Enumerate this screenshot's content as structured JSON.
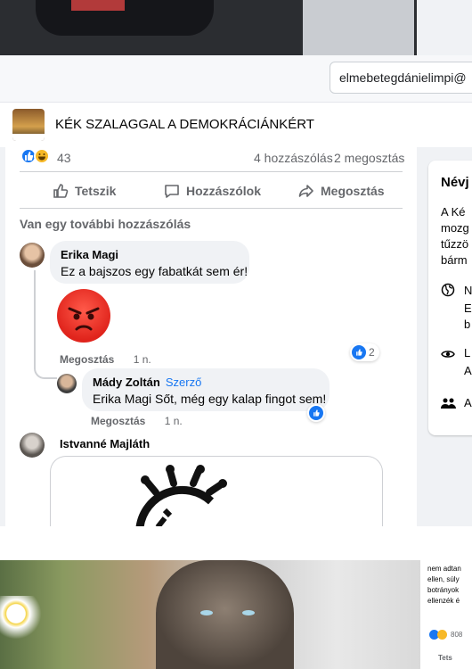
{
  "top_bar": {
    "email_value": "elmebetegdánielimpi@"
  },
  "page": {
    "title": "KÉK SZALAGGAL A DEMOKRÁCIÁNKÉRT"
  },
  "post_stats": {
    "reaction_count": "43",
    "comments": "4 hozzászólás",
    "shares": "2 megosztás"
  },
  "actions": {
    "like": "Tetszik",
    "comment": "Hozzászólok",
    "share": "Megosztás"
  },
  "comments_section": {
    "more_comments": "Van egy további hozzászólás",
    "comments": [
      {
        "author": "Erika Magi",
        "text": "Ez a bajszos egy fabatkát sem ér!",
        "action": "Megosztás",
        "time": "1 n.",
        "likes": "2"
      },
      {
        "author": "Mády Zoltán",
        "badge": "Szerző",
        "text": "Erika Magi Sőt, még egy kalap fingot sem!",
        "action": "Megosztás",
        "time": "1 n."
      },
      {
        "author": "Istvanné Majláth"
      }
    ]
  },
  "side_panel": {
    "title": "Névj",
    "text_lines": [
      "A Ké",
      "mozg",
      "tűzzö",
      "bárm"
    ],
    "info_lines": [
      "N",
      "E",
      "b",
      "L",
      "A",
      "A"
    ]
  },
  "bottom_right": {
    "lines": [
      "nem adtan",
      "ellen, súly",
      "botrányok",
      "ellenzék é"
    ],
    "count": "808",
    "action": "Tets"
  }
}
